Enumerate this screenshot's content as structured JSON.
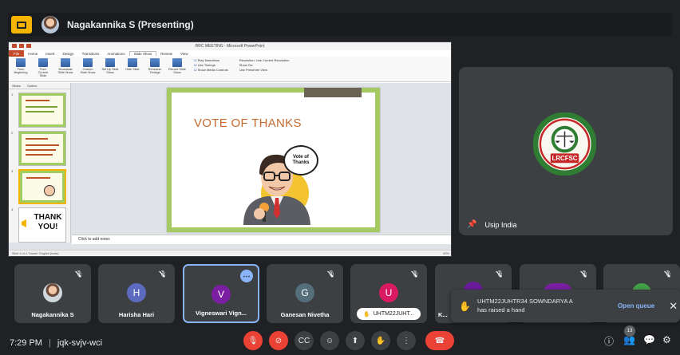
{
  "top_bar": {
    "presenter_text": "Nagakannika S (Presenting)"
  },
  "shared_screen": {
    "window_title": "RRC MEETING - Microsoft PowerPoint",
    "ribbon_tabs": [
      "File",
      "Home",
      "Insert",
      "Design",
      "Transitions",
      "Animations",
      "Slide Show",
      "Review",
      "View"
    ],
    "ribbon_buttons": [
      "From Beginning",
      "From Current Slide",
      "Broadcast Slide Show",
      "Custom Slide Show",
      "Set Up Slide Show",
      "Hide Slide",
      "Rehearse Timings",
      "Record Slide Show"
    ],
    "ribbon_checks": [
      "Play Narrations",
      "Use Timings",
      "Show Media Controls"
    ],
    "ribbon_monitor": [
      "Resolution: Use Current Resolution",
      "Show On:",
      "Use Presenter View"
    ],
    "ribbon_groups": [
      "Start Slide Show",
      "Set Up",
      "Monitors"
    ],
    "thumb_tabs": [
      "Slides",
      "Outline"
    ],
    "thumb_numbers": [
      "1",
      "2",
      "3",
      "4"
    ],
    "thumb_thankyou": "THANK YOU!",
    "slide_title": "VOTE OF THANKS",
    "bubble_text": "Vote of Thanks",
    "notes_placeholder": "Click to add notes",
    "status_left": "Slide 4 of 4   \"Austin\"   English (India)",
    "status_right": "60%"
  },
  "pinned": {
    "name": "Usip India",
    "logo_text": "LRCFSC"
  },
  "participants": [
    {
      "name": "Nagakannika S",
      "initial": "",
      "color": "#3c4043"
    },
    {
      "name": "Harisha Hari",
      "initial": "H",
      "color": "#5c6bc0"
    },
    {
      "name": "Vigneswari Vign...",
      "initial": "V",
      "color": "#7b1fa2"
    },
    {
      "name": "Ganesan Nivetha",
      "initial": "G",
      "color": "#546e7a"
    },
    {
      "name": "UHTM22JUHT...",
      "initial": "U",
      "color": "#d81b60"
    },
    {
      "name": "K...",
      "initial": "",
      "color": "#6a1b9a"
    },
    {
      "name": "",
      "initial": "U U",
      "color": "#7b1fa2"
    },
    {
      "name": "",
      "initial": "",
      "color": "#43a047"
    }
  ],
  "raise_hand": {
    "line1": "UHTM22JUHTR34 SOWNDARYA A",
    "line2": "has raised a hand",
    "action": "Open queue"
  },
  "bottom": {
    "time": "7:29 PM",
    "meeting_code": "jqk-svjv-wci",
    "people_count": "13"
  },
  "colors": {
    "background": "#202124",
    "tile": "#3c4043",
    "accent": "#8ab4f8",
    "danger": "#ea4335",
    "present_yellow": "#f4b400"
  }
}
